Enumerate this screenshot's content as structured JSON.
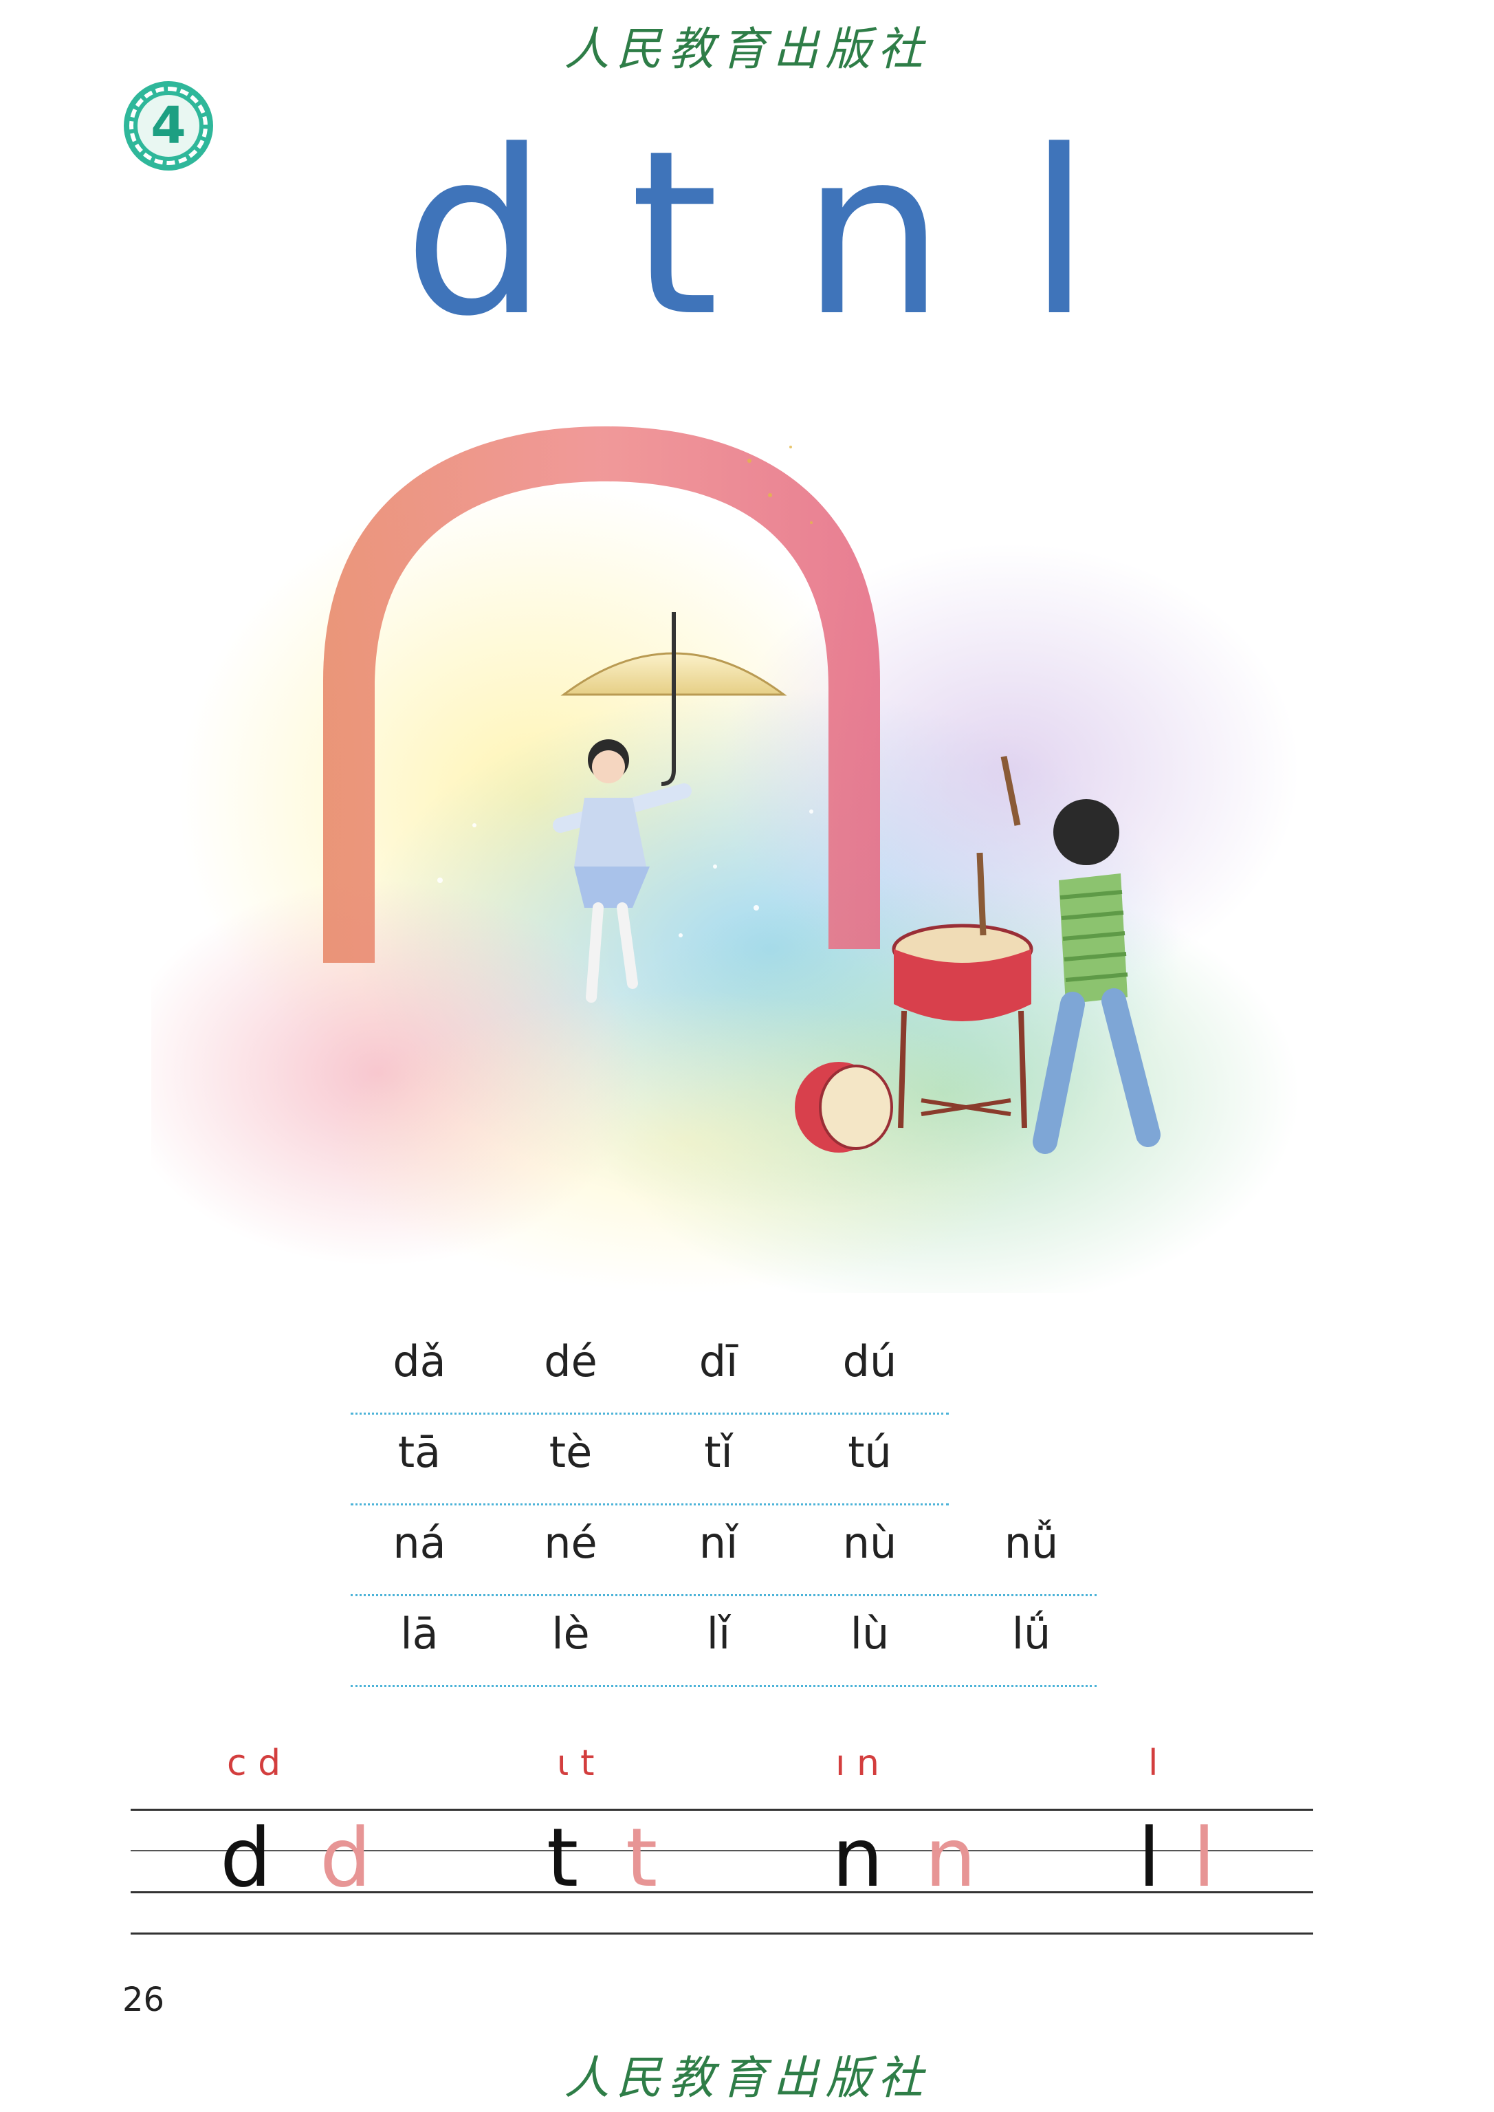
{
  "publisher": "人民教育出版社",
  "lesson": {
    "number": "4"
  },
  "title_letters": [
    "d",
    "t",
    "n",
    "l"
  ],
  "syllables": [
    [
      "dǎ",
      "dé",
      "dī",
      "dú",
      ""
    ],
    [
      "tā",
      "tè",
      "tǐ",
      "tú",
      ""
    ],
    [
      "ná",
      "né",
      "nǐ",
      "nù",
      "nǚ"
    ],
    [
      "lā",
      "lè",
      "lǐ",
      "lù",
      "lǘ"
    ]
  ],
  "writing": {
    "d": {
      "hint": "c d",
      "model": "d",
      "trace": "d"
    },
    "t": {
      "hint": "ι t",
      "model": "t",
      "trace": "t"
    },
    "n": {
      "hint": "ı n",
      "model": "n",
      "trace": "n"
    },
    "l": {
      "hint": "l",
      "model": "l",
      "trace": "l"
    }
  },
  "page_number": "26",
  "colors": {
    "title": "#3f74ba",
    "publisher": "#2e7d47",
    "badge": "#2fb79a",
    "rule": "#4cb3d8",
    "hint": "#d33e3e",
    "trace": "#e79595"
  },
  "illustration": {
    "description_icon": "girl-dancing-with-umbrella-and-boy-drumming-under-arch-icon"
  }
}
